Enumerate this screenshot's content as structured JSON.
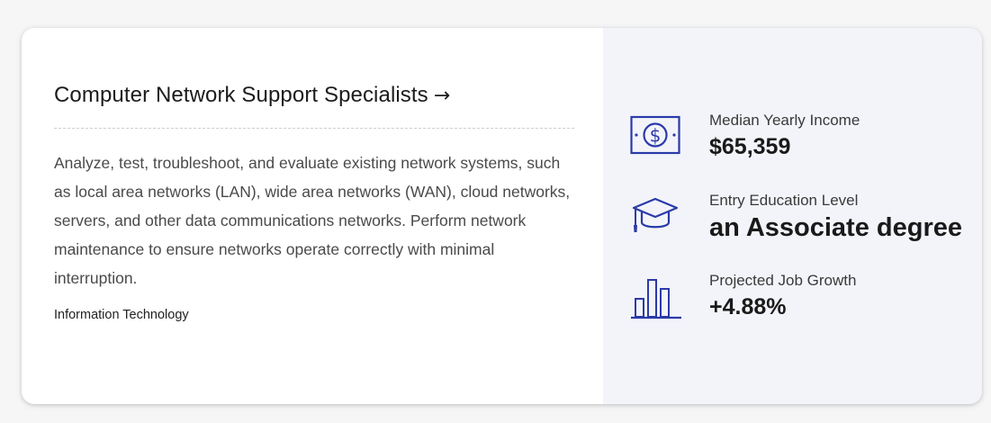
{
  "colors": {
    "icon": "#2b3aa8",
    "panel": "#f3f4fa",
    "card": "#ffffff"
  },
  "occupation": {
    "title": "Computer Network Support Specialists",
    "arrow": "→",
    "description": "Analyze, test, troubleshoot, and evaluate existing network systems, such as local area networks (LAN), wide area networks (WAN), cloud networks, servers, and other data communications networks. Perform network maintenance to ensure networks operate correctly with minimal interruption.",
    "category": "Information Technology"
  },
  "stats": {
    "income": {
      "icon": "dollar-bill-icon",
      "label": "Median Yearly Income",
      "value": "$65,359"
    },
    "education": {
      "icon": "graduation-cap-icon",
      "label": "Entry Education Level",
      "value": "an Associate degree"
    },
    "growth": {
      "icon": "bar-chart-icon",
      "label": "Projected Job Growth",
      "value": "+4.88%"
    }
  }
}
